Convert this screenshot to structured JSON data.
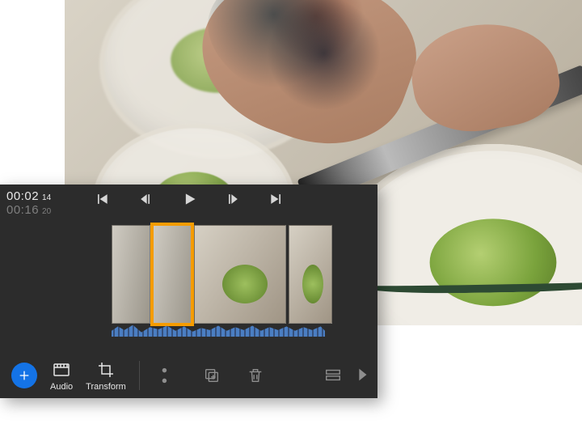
{
  "background_image": {
    "description": "chef-hands-grating-over-bowls"
  },
  "timecode": {
    "current": "00:02",
    "current_frames": "14",
    "total": "00:16",
    "total_frames": "20"
  },
  "transport": {
    "go_start_title": "Go to start",
    "step_back_title": "Step back one frame",
    "play_title": "Play",
    "step_fwd_title": "Step forward one frame",
    "go_end_title": "Go to end"
  },
  "timeline": {
    "clips": [
      {
        "id": "clip1",
        "selected": false
      },
      {
        "id": "clip2",
        "selected": true
      },
      {
        "id": "clip3",
        "selected": false
      },
      {
        "id": "clip4",
        "selected": false
      }
    ]
  },
  "toolbar": {
    "add_title": "Add",
    "audio_label": "Audio",
    "transform_label": "Transform",
    "cut_title": "Cut",
    "duplicate_title": "Duplicate",
    "delete_title": "Delete",
    "insert_gap_title": "Insert gap",
    "more_title": "More"
  }
}
